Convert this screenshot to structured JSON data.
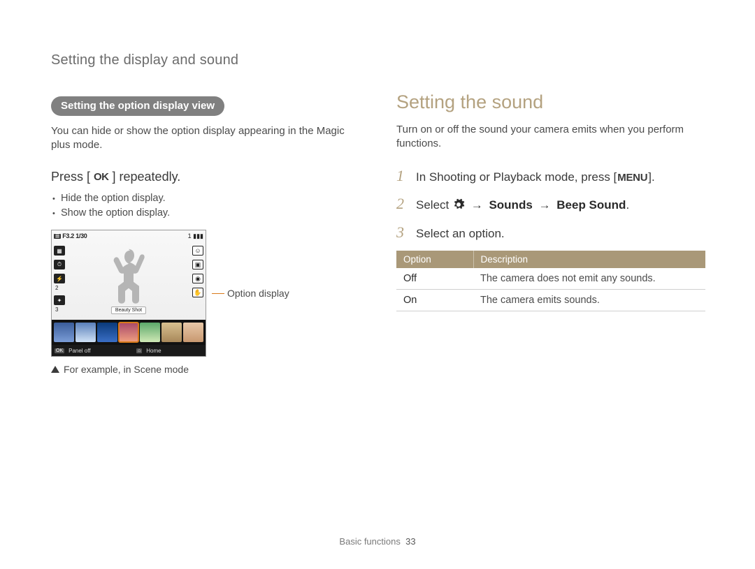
{
  "breadcrumb": "Setting the display and sound",
  "left": {
    "pill": "Setting the option display view",
    "intro": "You can hide or show the option display appearing in the Magic plus mode.",
    "press_prefix": "Press [",
    "press_ok": "OK",
    "press_suffix": "] repeatedly.",
    "bullets": [
      "Hide the option display.",
      "Show the option display."
    ],
    "lcd": {
      "status": "F3.2 1/30",
      "battery": "1 ▮▮▮",
      "beauty": "Beauty Shot",
      "panel_key": "OK",
      "panel_off": "Panel off",
      "home_key": "⌂",
      "home": "Home"
    },
    "callout": "Option display",
    "footnote": "For example, in Scene mode"
  },
  "right": {
    "title": "Setting the sound",
    "intro": "Turn on or off the sound your camera emits when you perform functions.",
    "steps": {
      "s1_pre": "In Shooting or Playback mode, press [",
      "s1_menu": "MENU",
      "s1_post": "].",
      "s2_pre": "Select ",
      "s2_arrow1": "→",
      "s2_b1": "Sounds",
      "s2_arrow2": "→",
      "s2_b2": "Beep Sound",
      "s2_post": ".",
      "s3": "Select an option."
    },
    "table": {
      "head_option": "Option",
      "head_desc": "Description",
      "rows": [
        {
          "opt": "Off",
          "desc": "The camera does not emit any sounds."
        },
        {
          "opt": "On",
          "desc": "The camera emits sounds."
        }
      ]
    }
  },
  "footer": {
    "section": "Basic functions",
    "page": "33"
  }
}
